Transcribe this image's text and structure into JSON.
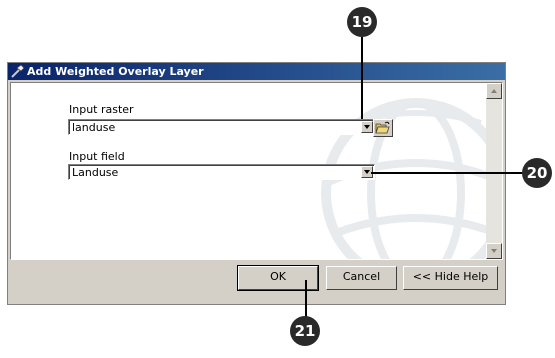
{
  "dialog": {
    "title": "Add Weighted Overlay Layer",
    "input_raster_label": "Input raster",
    "input_raster_value": "landuse",
    "input_field_label": "Input field",
    "input_field_value": "Landuse"
  },
  "buttons": {
    "ok": "OK",
    "cancel": "Cancel",
    "hide_help": "<< Hide Help"
  },
  "callouts": {
    "c19": "19",
    "c20": "20",
    "c21": "21"
  }
}
